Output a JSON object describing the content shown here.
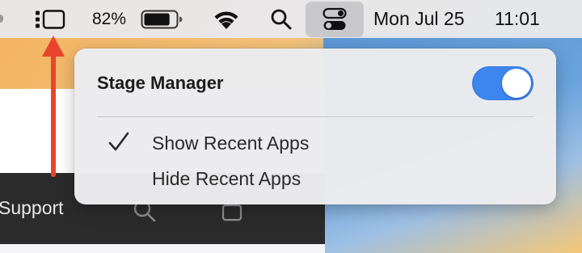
{
  "menubar": {
    "battery_percent": "82%",
    "date": "Mon Jul 25",
    "time": "11:01",
    "icons": [
      "stage-manager-icon",
      "battery-icon",
      "wifi-icon",
      "spotlight-search-icon",
      "control-center-icon"
    ],
    "battery_level": 0.82
  },
  "popover": {
    "title": "Stage Manager",
    "toggle_on": true,
    "options": [
      {
        "label": "Show Recent Apps",
        "checked": true
      },
      {
        "label": "Hide Recent Apps",
        "checked": false
      }
    ]
  },
  "browser": {
    "nav_support_label": "Support"
  },
  "colors": {
    "toggle_on": "#3d86f0",
    "annotation_arrow": "#e8452c",
    "menubar_bg": "#e8e8ea",
    "browser_nav_bg": "#2b2b2b"
  }
}
